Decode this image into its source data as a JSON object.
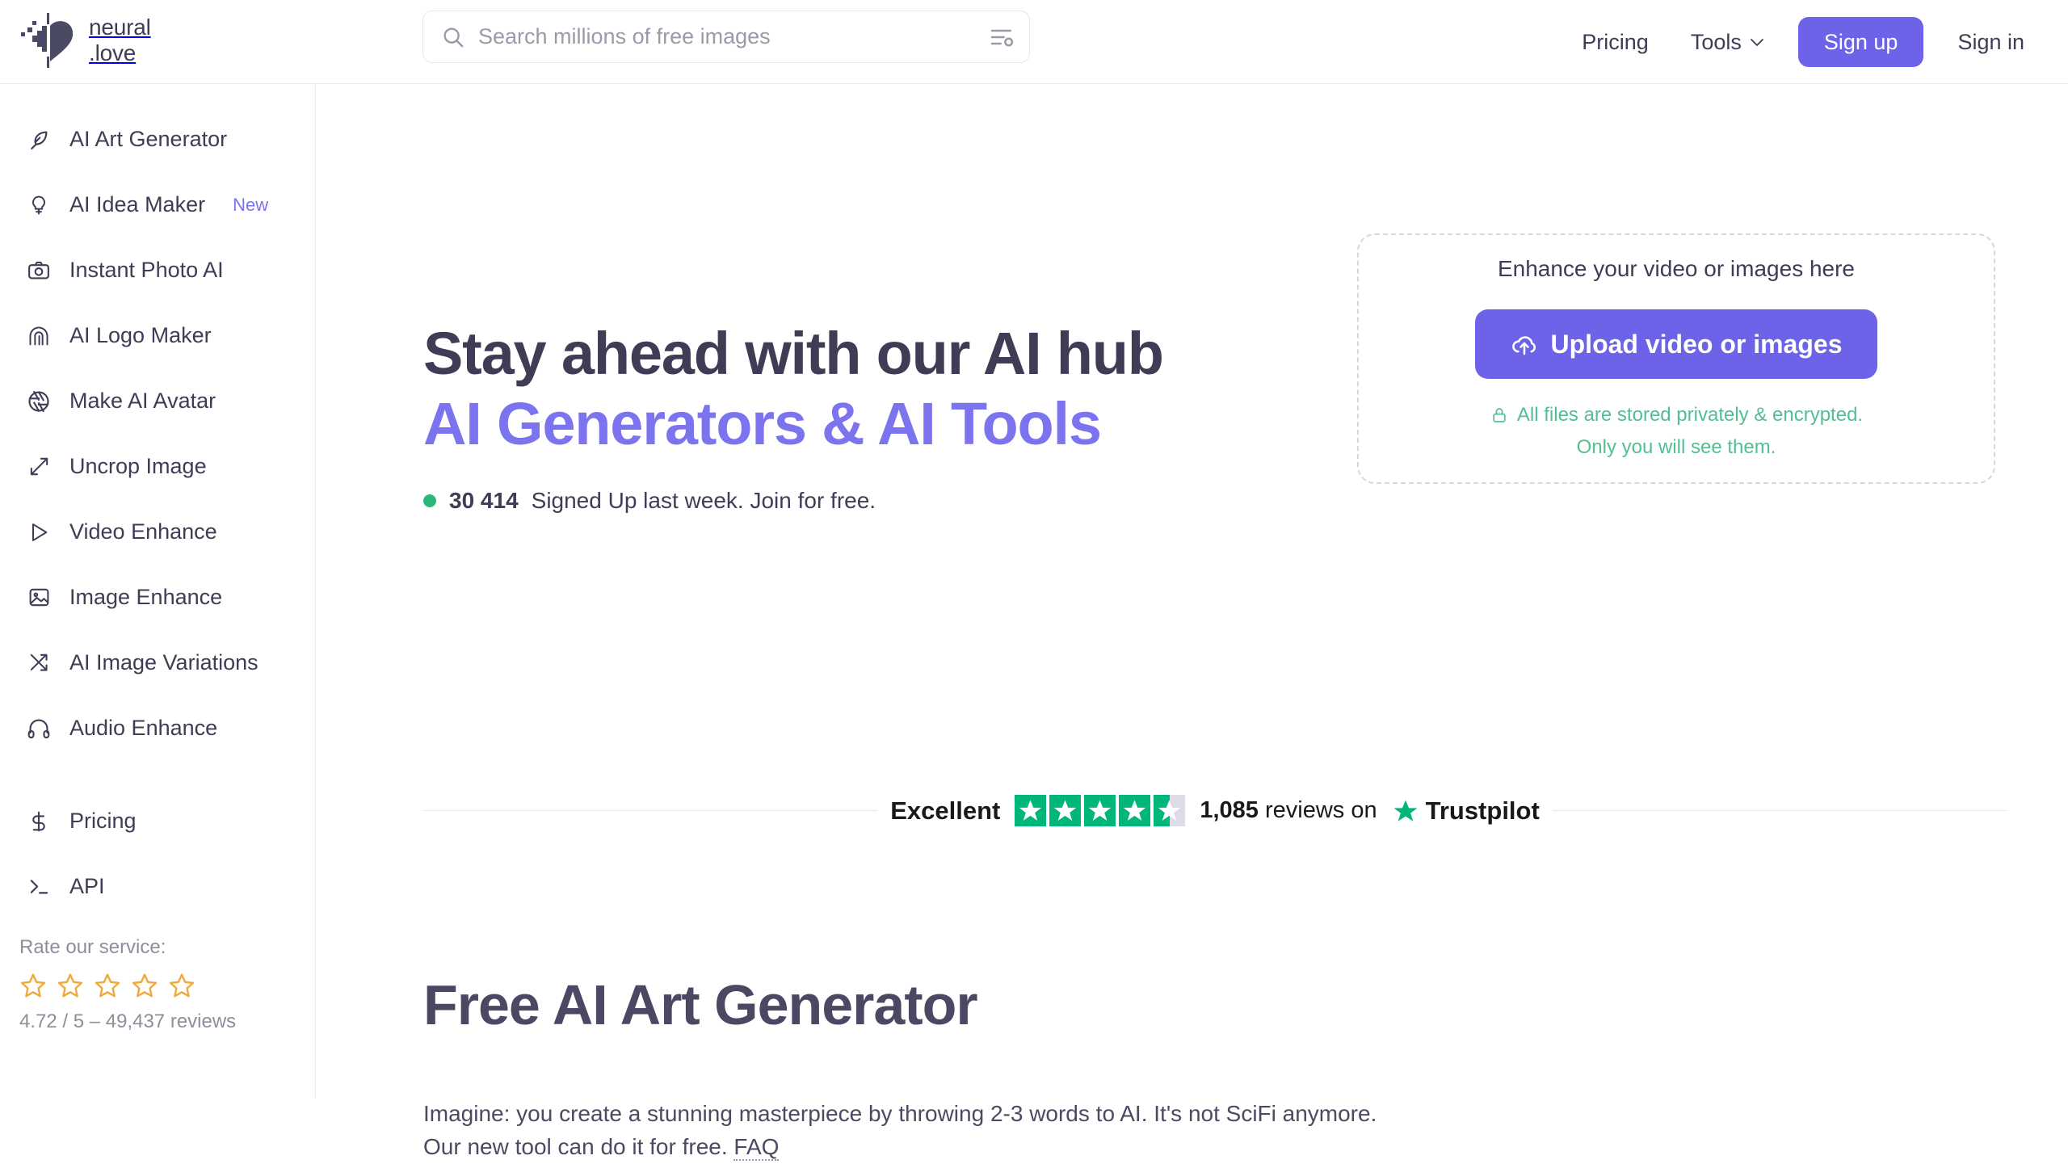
{
  "brand": {
    "name_line1": "neural",
    "name_line2": ".love",
    "logo_icon": "pixel-heart-icon"
  },
  "search": {
    "placeholder": "Search millions of free images",
    "value": "",
    "icon": "search-icon",
    "filter_icon": "filter-settings-icon"
  },
  "topnav": {
    "pricing": "Pricing",
    "tools": "Tools",
    "tools_chevron_icon": "chevron-down-icon",
    "signup": "Sign up",
    "signin": "Sign in",
    "accent_color": "#6c63e8"
  },
  "sidebar": {
    "items": [
      {
        "label": "AI Art Generator",
        "icon": "feather-icon",
        "badge": ""
      },
      {
        "label": "AI Idea Maker",
        "icon": "lightbulb-icon",
        "badge": "New"
      },
      {
        "label": "Instant Photo AI",
        "icon": "camera-icon",
        "badge": ""
      },
      {
        "label": "AI Logo Maker",
        "icon": "arch-logo-icon",
        "badge": ""
      },
      {
        "label": "Make AI Avatar",
        "icon": "aperture-icon",
        "badge": ""
      },
      {
        "label": "Uncrop Image",
        "icon": "expand-diagonal-icon",
        "badge": ""
      },
      {
        "label": "Video Enhance",
        "icon": "play-triangle-icon",
        "badge": ""
      },
      {
        "label": "Image Enhance",
        "icon": "image-icon",
        "badge": ""
      },
      {
        "label": "AI Image Variations",
        "icon": "shuffle-icon",
        "badge": ""
      },
      {
        "label": "Audio Enhance",
        "icon": "headphones-icon",
        "badge": ""
      }
    ],
    "items_secondary": [
      {
        "label": "Pricing",
        "icon": "dollar-icon",
        "badge": ""
      },
      {
        "label": "API",
        "icon": "terminal-icon",
        "badge": ""
      }
    ],
    "rating": {
      "title": "Rate our service:",
      "stars": 5,
      "star_icon": "star-outline-icon",
      "star_color": "#f0a93b",
      "summary": "4.72 / 5 – 49,437 reviews"
    }
  },
  "hero": {
    "title_line1": "Stay ahead with our AI hub",
    "title_line2": "AI Generators & AI Tools",
    "accent_color": "#7c73ef",
    "signups_count": "30 414",
    "signups_text": "Signed Up last week. Join for free.",
    "status_dot_color": "#2ab87a"
  },
  "dropzone": {
    "title": "Enhance your video or images here",
    "button_label": "Upload video or images",
    "button_icon": "cloud-upload-icon",
    "note_icon": "lock-icon",
    "note_line1": "All files are stored privately & encrypted.",
    "note_line2": "Only you will see them.",
    "note_color": "#53be92"
  },
  "trustpilot": {
    "rating_word": "Excellent",
    "stars_filled": 4.5,
    "stars_total": 5,
    "star_color": "#00b67a",
    "reviews_count": "1,085",
    "reviews_label": "reviews on",
    "brand": "Trustpilot",
    "brand_star_icon": "trustpilot-star-icon"
  },
  "section": {
    "title": "Free AI Art Generator",
    "body_line1": "Imagine: you create a stunning masterpiece by throwing 2-3 words to AI. It's not SciFi anymore.",
    "body_line2_pre": "Our new tool can do it for free. ",
    "faq_label": "FAQ"
  }
}
